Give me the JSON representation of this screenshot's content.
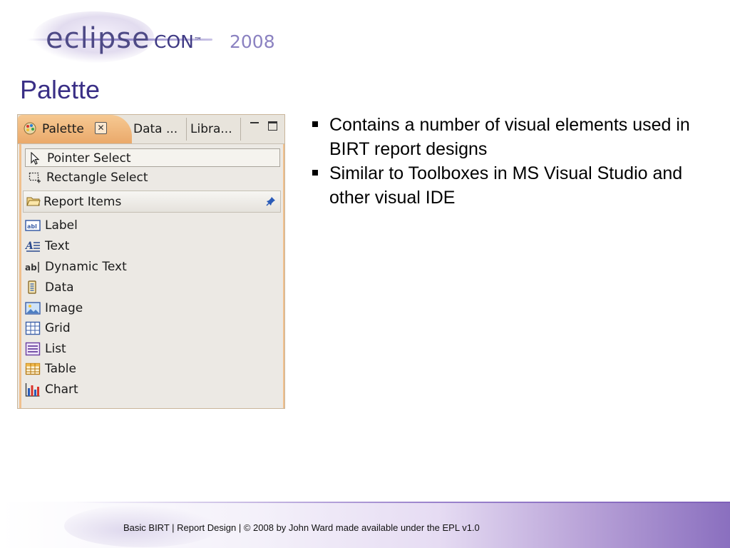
{
  "logo": {
    "brand": "eclipse",
    "con": "CON",
    "tm": "™",
    "year": "2008"
  },
  "slide_title": "Palette",
  "palette": {
    "tabs": [
      {
        "label": "Palette",
        "active": true
      },
      {
        "label": "Data ...",
        "active": false
      },
      {
        "label": "Libra...",
        "active": false
      }
    ],
    "tools": [
      {
        "label": "Pointer Select",
        "icon": "pointer-icon",
        "selected": true
      },
      {
        "label": "Rectangle Select",
        "icon": "rectangle-select-icon",
        "selected": false
      }
    ],
    "drawer": {
      "label": "Report Items",
      "icon": "folder-icon"
    },
    "items": [
      {
        "label": "Label",
        "icon": "label-icon"
      },
      {
        "label": "Text",
        "icon": "text-icon"
      },
      {
        "label": "Dynamic Text",
        "icon": "dynamic-text-icon"
      },
      {
        "label": "Data",
        "icon": "data-icon"
      },
      {
        "label": "Image",
        "icon": "image-icon"
      },
      {
        "label": "Grid",
        "icon": "grid-icon"
      },
      {
        "label": "List",
        "icon": "list-icon"
      },
      {
        "label": "Table",
        "icon": "table-icon"
      },
      {
        "label": "Chart",
        "icon": "chart-icon"
      }
    ]
  },
  "bullets": [
    "Contains a number of visual elements used in BIRT report designs",
    "Similar to Toolboxes in MS Visual Studio and other visual IDE"
  ],
  "footer": "Basic BIRT  |  Report Design  |  © 2008 by John Ward made available under the EPL v1.0",
  "colors": {
    "title": "#3a2f86",
    "tab_active": "#eaa96b",
    "footer_accent": "#8a6fbf"
  }
}
